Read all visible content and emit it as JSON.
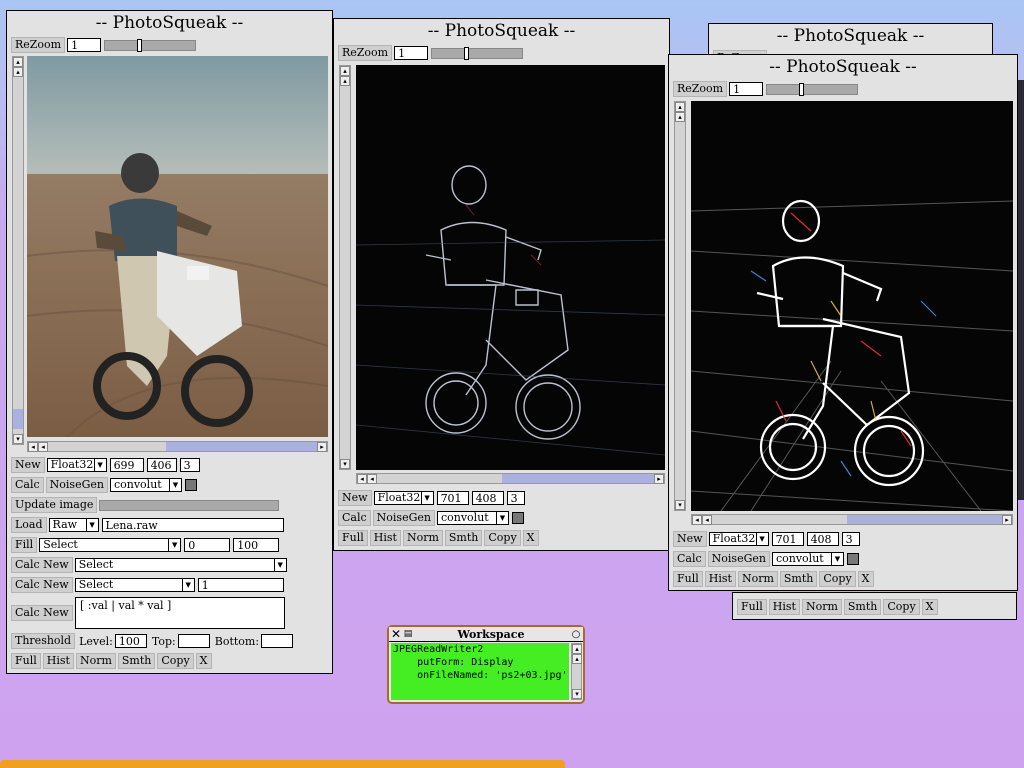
{
  "app": {
    "window_title": "-- PhotoSqueak --"
  },
  "zoom": {
    "button": "ReZoom",
    "value": "1"
  },
  "top_window_stub": {
    "rezoom": "ReZoom"
  },
  "win1": {
    "new_label": "New",
    "type": "Float32",
    "width": "699",
    "height": "406",
    "channels": "3",
    "calc_label": "Calc",
    "noisegen_label": "NoiseGen",
    "op": "convolut",
    "update_label": "Update image",
    "load_label": "Load",
    "format": "Raw",
    "filename": "Lena.raw",
    "fill_label": "Fill",
    "fill_select": "Select",
    "fill_from": "0",
    "fill_to": "100",
    "calcnew_label": "Calc New",
    "calcnew1_select": "Select",
    "calcnew2_select": "Select",
    "calcnew2_value": "1",
    "expression": "[ :val | val * val ]",
    "threshold_label": "Threshold",
    "level_label": "Level:",
    "level_value": "100",
    "top_label": "Top:",
    "top_value": "",
    "bottom_label": "Bottom:",
    "bottom_value": ""
  },
  "win2": {
    "new_label": "New",
    "type": "Float32",
    "width": "701",
    "height": "408",
    "channels": "3",
    "calc_label": "Calc",
    "noisegen_label": "NoiseGen",
    "op": "convolut"
  },
  "win3": {
    "new_label": "New",
    "type": "Float32",
    "width": "701",
    "height": "408",
    "channels": "3",
    "calc_label": "Calc",
    "noisegen_label": "NoiseGen",
    "op": "convolut"
  },
  "toolbar": {
    "full": "Full",
    "hist": "Hist",
    "norm": "Norm",
    "smth": "Smth",
    "copy": "Copy",
    "close": "X"
  },
  "workspace": {
    "title": "Workspace",
    "lines": [
      "JPEGReadWriter2",
      "    putForm: Display",
      "    onFileNamed: 'ps2+03.jpg'."
    ]
  },
  "icons": [
    "close-icon",
    "menu-icon",
    "collapse-icon",
    "scroll-up-icon",
    "scroll-down-icon",
    "scroll-left-icon",
    "scroll-right-icon",
    "dropdown-arrow-icon"
  ]
}
